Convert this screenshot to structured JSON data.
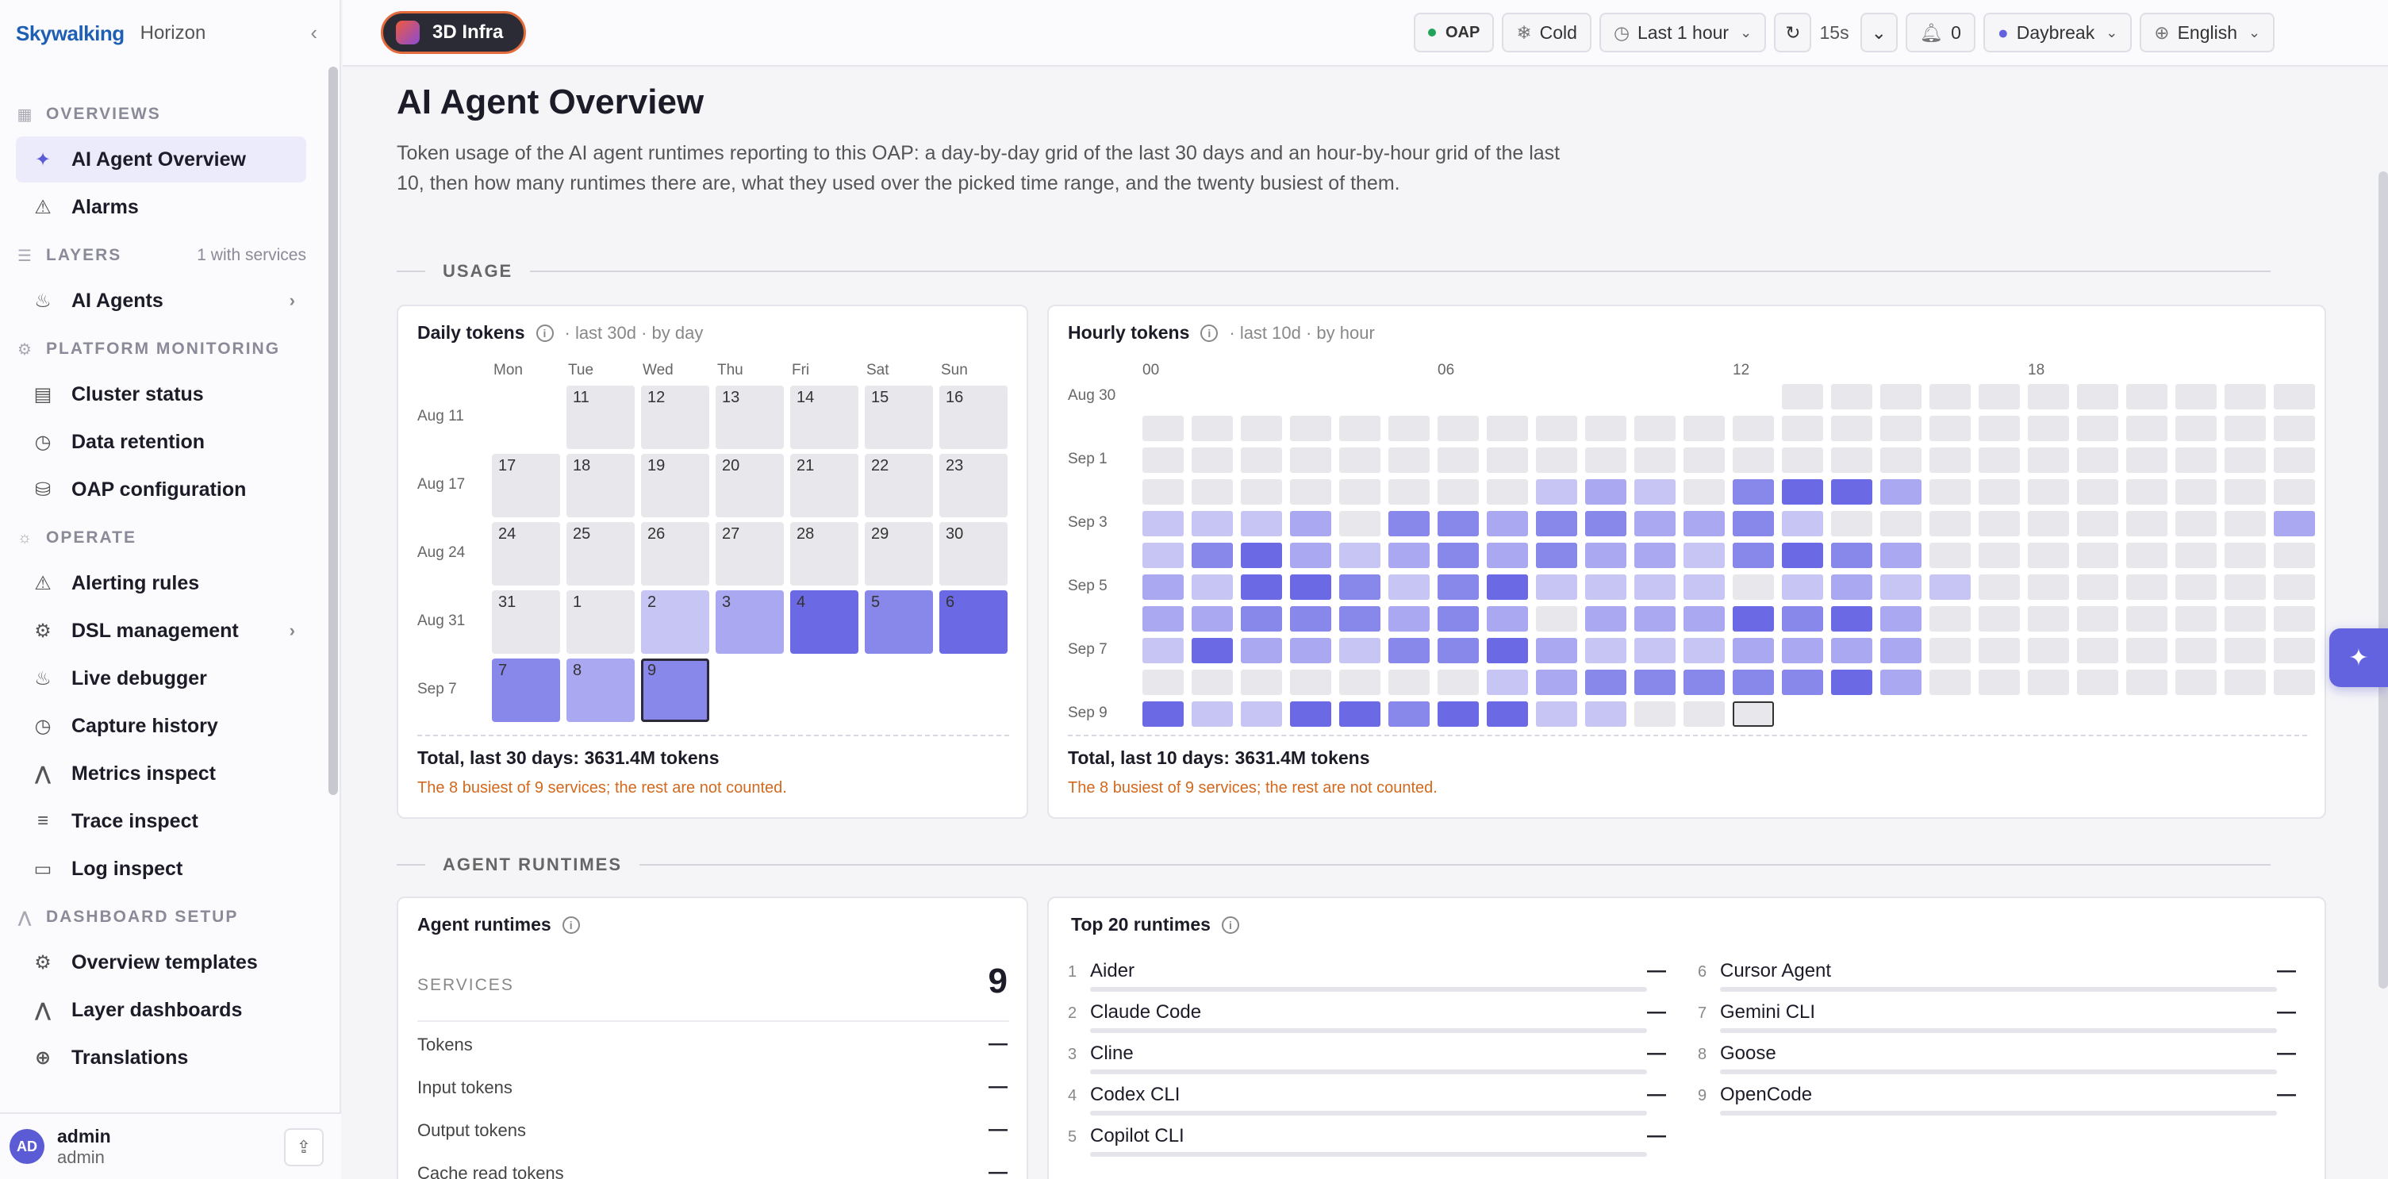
{
  "brand": {
    "logo": "Skywalking",
    "product": "Horizon"
  },
  "sidebar": {
    "sections": [
      {
        "label": "OVERVIEWS",
        "icon": "grid-icon",
        "extra": ""
      },
      {
        "label": "LAYERS",
        "icon": "layers-icon",
        "extra": "1 with services"
      },
      {
        "label": "PLATFORM MONITORING",
        "icon": "gear-icon",
        "extra": ""
      },
      {
        "label": "OPERATE",
        "icon": "sun-icon",
        "extra": ""
      },
      {
        "label": "DASHBOARD SETUP",
        "icon": "chart-icon",
        "extra": ""
      }
    ],
    "items": [
      {
        "label": "AI Agent Overview",
        "icon": "sparkle-icon"
      },
      {
        "label": "Alarms",
        "icon": "warning-icon"
      },
      {
        "label": "AI Agents",
        "icon": "flame-icon"
      },
      {
        "label": "Cluster status",
        "icon": "server-icon"
      },
      {
        "label": "Data retention",
        "icon": "clock-icon"
      },
      {
        "label": "OAP configuration",
        "icon": "database-icon"
      },
      {
        "label": "Alerting rules",
        "icon": "warning-icon"
      },
      {
        "label": "DSL management",
        "icon": "gear-icon"
      },
      {
        "label": "Live debugger",
        "icon": "flame-icon"
      },
      {
        "label": "Capture history",
        "icon": "clock-icon"
      },
      {
        "label": "Metrics inspect",
        "icon": "chart-icon"
      },
      {
        "label": "Trace inspect",
        "icon": "list-icon"
      },
      {
        "label": "Log inspect",
        "icon": "document-icon"
      },
      {
        "label": "Overview templates",
        "icon": "gear-icon"
      },
      {
        "label": "Layer dashboards",
        "icon": "chart-icon"
      },
      {
        "label": "Translations",
        "icon": "globe-icon"
      }
    ]
  },
  "user": {
    "initials": "AD",
    "name": "admin",
    "role": "admin"
  },
  "topbar": {
    "infra": "3D Infra",
    "oap": "OAP",
    "cold": "Cold",
    "range": "Last 1 hour",
    "refresh": "15s",
    "alerts": "0",
    "theme": "Daybreak",
    "language": "English"
  },
  "page": {
    "title": "AI Agent Overview",
    "description": "Token usage of the AI agent runtimes reporting to this OAP: a day-by-day grid of the last 30 days and an hour-by-hour grid of the last 10, then how many runtimes there are, what they used over the picked time range, and the twenty busiest of them."
  },
  "usage": {
    "section": "USAGE",
    "daily": {
      "title": "Daily tokens",
      "meta": "· last 30d · by day",
      "days": [
        "Mon",
        "Tue",
        "Wed",
        "Thu",
        "Fri",
        "Sat",
        "Sun"
      ],
      "weeks": [
        "Aug 11",
        "Aug 17",
        "Aug 24",
        "Aug 31",
        "Sep 7"
      ],
      "total": "Total, last 30 days: 3631.4M tokens",
      "note": "The 8 busiest of 9 services; the rest are not counted."
    },
    "hourly": {
      "title": "Hourly tokens",
      "meta": "· last 10d · by hour",
      "hours": [
        "00",
        "06",
        "12",
        "18"
      ],
      "rows": [
        "Aug 30",
        "Sep 1",
        "Sep 3",
        "Sep 5",
        "Sep 7",
        "Sep 9"
      ],
      "total": "Total, last 10 days: 3631.4M tokens",
      "note": "The 8 busiest of 9 services; the rest are not counted."
    }
  },
  "runtimes": {
    "section": "AGENT RUNTIMES",
    "summary": {
      "title": "Agent runtimes",
      "services_label": "SERVICES",
      "services_value": "9",
      "rows": [
        {
          "label": "Tokens",
          "value": "—"
        },
        {
          "label": "Input tokens",
          "value": "—"
        },
        {
          "label": "Output tokens",
          "value": "—"
        },
        {
          "label": "Cache read tokens",
          "value": "—"
        }
      ]
    },
    "top": {
      "title": "Top 20 runtimes",
      "items": [
        {
          "rank": "1",
          "name": "Aider",
          "value": "—"
        },
        {
          "rank": "2",
          "name": "Claude Code",
          "value": "—"
        },
        {
          "rank": "3",
          "name": "Cline",
          "value": "—"
        },
        {
          "rank": "4",
          "name": "Codex CLI",
          "value": "—"
        },
        {
          "rank": "5",
          "name": "Copilot CLI",
          "value": "—"
        },
        {
          "rank": "6",
          "name": "Cursor Agent",
          "value": "—"
        },
        {
          "rank": "7",
          "name": "Gemini CLI",
          "value": "—"
        },
        {
          "rank": "8",
          "name": "Goose",
          "value": "—"
        },
        {
          "rank": "9",
          "name": "OpenCode",
          "value": "—"
        }
      ]
    }
  },
  "chart_data": [
    {
      "type": "heatmap",
      "title": "Daily tokens",
      "x": [
        "Mon",
        "Tue",
        "Wed",
        "Thu",
        "Fri",
        "Sat",
        "Sun"
      ],
      "y": [
        "Aug 11",
        "Aug 17",
        "Aug 24",
        "Aug 31",
        "Sep 7"
      ],
      "day_numbers": [
        [
          null,
          11,
          12,
          13,
          14,
          15,
          16
        ],
        [
          17,
          18,
          19,
          20,
          21,
          22,
          23
        ],
        [
          24,
          25,
          26,
          27,
          28,
          29,
          30
        ],
        [
          31,
          1,
          2,
          3,
          4,
          5,
          6
        ],
        [
          7,
          8,
          9,
          null,
          null,
          null,
          null
        ]
      ],
      "intensity": [
        [
          null,
          0,
          0,
          0,
          0,
          0,
          0
        ],
        [
          0,
          0,
          0,
          0,
          0,
          0,
          0
        ],
        [
          0,
          0,
          0,
          0,
          0,
          0,
          0
        ],
        [
          0,
          0,
          1,
          2,
          4,
          3,
          4
        ],
        [
          3,
          2,
          3,
          null,
          null,
          null,
          null
        ]
      ],
      "selected": "Sep 9"
    },
    {
      "type": "heatmap",
      "title": "Hourly tokens",
      "x_ticks": [
        "00",
        "06",
        "12",
        "18"
      ],
      "y_ticks": [
        "Aug 30",
        "Sep 1",
        "Sep 3",
        "Sep 5",
        "Sep 7",
        "Sep 9"
      ],
      "intensity": [
        [
          null,
          null,
          null,
          null,
          null,
          null,
          null,
          null,
          null,
          null,
          null,
          null,
          null,
          0,
          0,
          0,
          0,
          0,
          0,
          0,
          0,
          0,
          0,
          0
        ],
        [
          0,
          0,
          0,
          0,
          0,
          0,
          0,
          0,
          0,
          0,
          0,
          0,
          0,
          0,
          0,
          0,
          0,
          0,
          0,
          0,
          0,
          0,
          0,
          0
        ],
        [
          0,
          0,
          0,
          0,
          0,
          0,
          0,
          0,
          0,
          0,
          0,
          0,
          0,
          0,
          0,
          0,
          0,
          0,
          0,
          0,
          0,
          0,
          0,
          0
        ],
        [
          0,
          0,
          0,
          0,
          0,
          0,
          0,
          0,
          1,
          2,
          1,
          0,
          3,
          4,
          4,
          2,
          0,
          0,
          0,
          0,
          0,
          0,
          0,
          0
        ],
        [
          1,
          1,
          1,
          2,
          0,
          3,
          3,
          2,
          3,
          3,
          2,
          2,
          3,
          1,
          0,
          0,
          0,
          0,
          0,
          0,
          0,
          0,
          0,
          2
        ],
        [
          1,
          3,
          4,
          2,
          1,
          2,
          3,
          2,
          3,
          2,
          2,
          1,
          3,
          4,
          3,
          2,
          0,
          0,
          0,
          0,
          0,
          0,
          0,
          0
        ],
        [
          2,
          1,
          4,
          4,
          3,
          1,
          3,
          4,
          1,
          1,
          1,
          1,
          0,
          1,
          2,
          1,
          1,
          0,
          0,
          0,
          0,
          0,
          0,
          0
        ],
        [
          2,
          2,
          3,
          3,
          3,
          2,
          3,
          2,
          0,
          2,
          2,
          2,
          4,
          3,
          4,
          2,
          0,
          0,
          0,
          0,
          0,
          0,
          0,
          0
        ],
        [
          1,
          4,
          2,
          2,
          1,
          3,
          3,
          4,
          2,
          1,
          1,
          1,
          2,
          2,
          2,
          2,
          0,
          0,
          0,
          0,
          0,
          0,
          0,
          0
        ],
        [
          0,
          0,
          0,
          0,
          0,
          0,
          0,
          1,
          2,
          3,
          3,
          3,
          3,
          3,
          4,
          2,
          0,
          0,
          0,
          0,
          0,
          0,
          0,
          0
        ],
        [
          4,
          1,
          1,
          4,
          4,
          3,
          4,
          4,
          1,
          1,
          0,
          0,
          0,
          null,
          null,
          null,
          null,
          null,
          null,
          null,
          null,
          null,
          null,
          null
        ]
      ],
      "selected": "Sep 9 12:00"
    }
  ]
}
